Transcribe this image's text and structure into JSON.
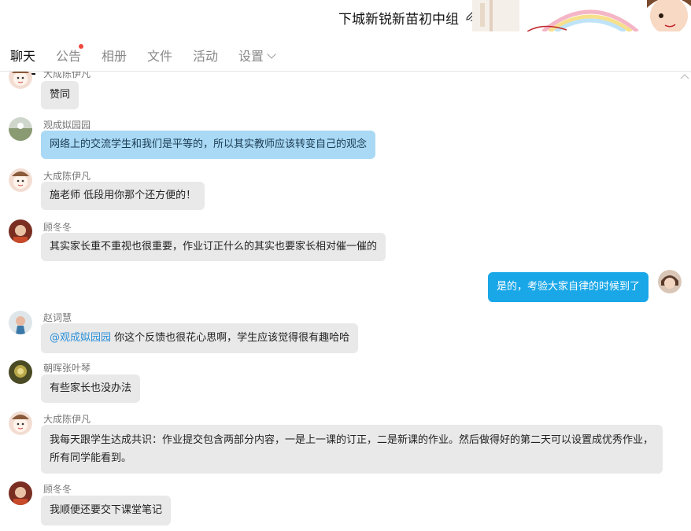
{
  "header": {
    "title": "下城新锐新苗初中组"
  },
  "tabs": [
    {
      "label": "聊天"
    },
    {
      "label": "公告"
    },
    {
      "label": "相册"
    },
    {
      "label": "文件"
    },
    {
      "label": "活动"
    },
    {
      "label": "设置"
    }
  ],
  "messages": [
    {
      "sender": "大成陈伊凡",
      "text": "赞同"
    },
    {
      "sender": "观成姒园园",
      "text": "网络上的交流学生和我们是平等的，所以其实教师应该转变自己的观念"
    },
    {
      "sender": "大成陈伊凡",
      "text": "施老师 低段用你那个还方便的！"
    },
    {
      "sender": "顾冬冬",
      "text": "其实家长重不重视也很重要，作业订正什么的其实也要家长相对催一催的"
    },
    {
      "sender": "",
      "text": "是的，考验大家自律的时候到了"
    },
    {
      "sender": "赵词慧",
      "mention": "@观成姒园园",
      "text": " 你这个反馈也很花心思啊，学生应该觉得很有趣哈哈"
    },
    {
      "sender": "朝晖张叶琴",
      "text": "有些家长也没办法"
    },
    {
      "sender": "大成陈伊凡",
      "text": "我每天跟学生达成共识：作业提交包含两部分内容，一是上一课的订正，二是新课的作业。然后做得好的第二天可以设置成优秀作业，所有同学能看到。"
    },
    {
      "sender": "顾冬冬",
      "text": "我顺便还要交下课堂笔记"
    }
  ],
  "colors": {
    "self_bubble": "#19a7e8",
    "other_bubble": "#e9e9e9",
    "highlight_bubble": "#a9d9f5",
    "notice_dot": "#f0483e"
  }
}
